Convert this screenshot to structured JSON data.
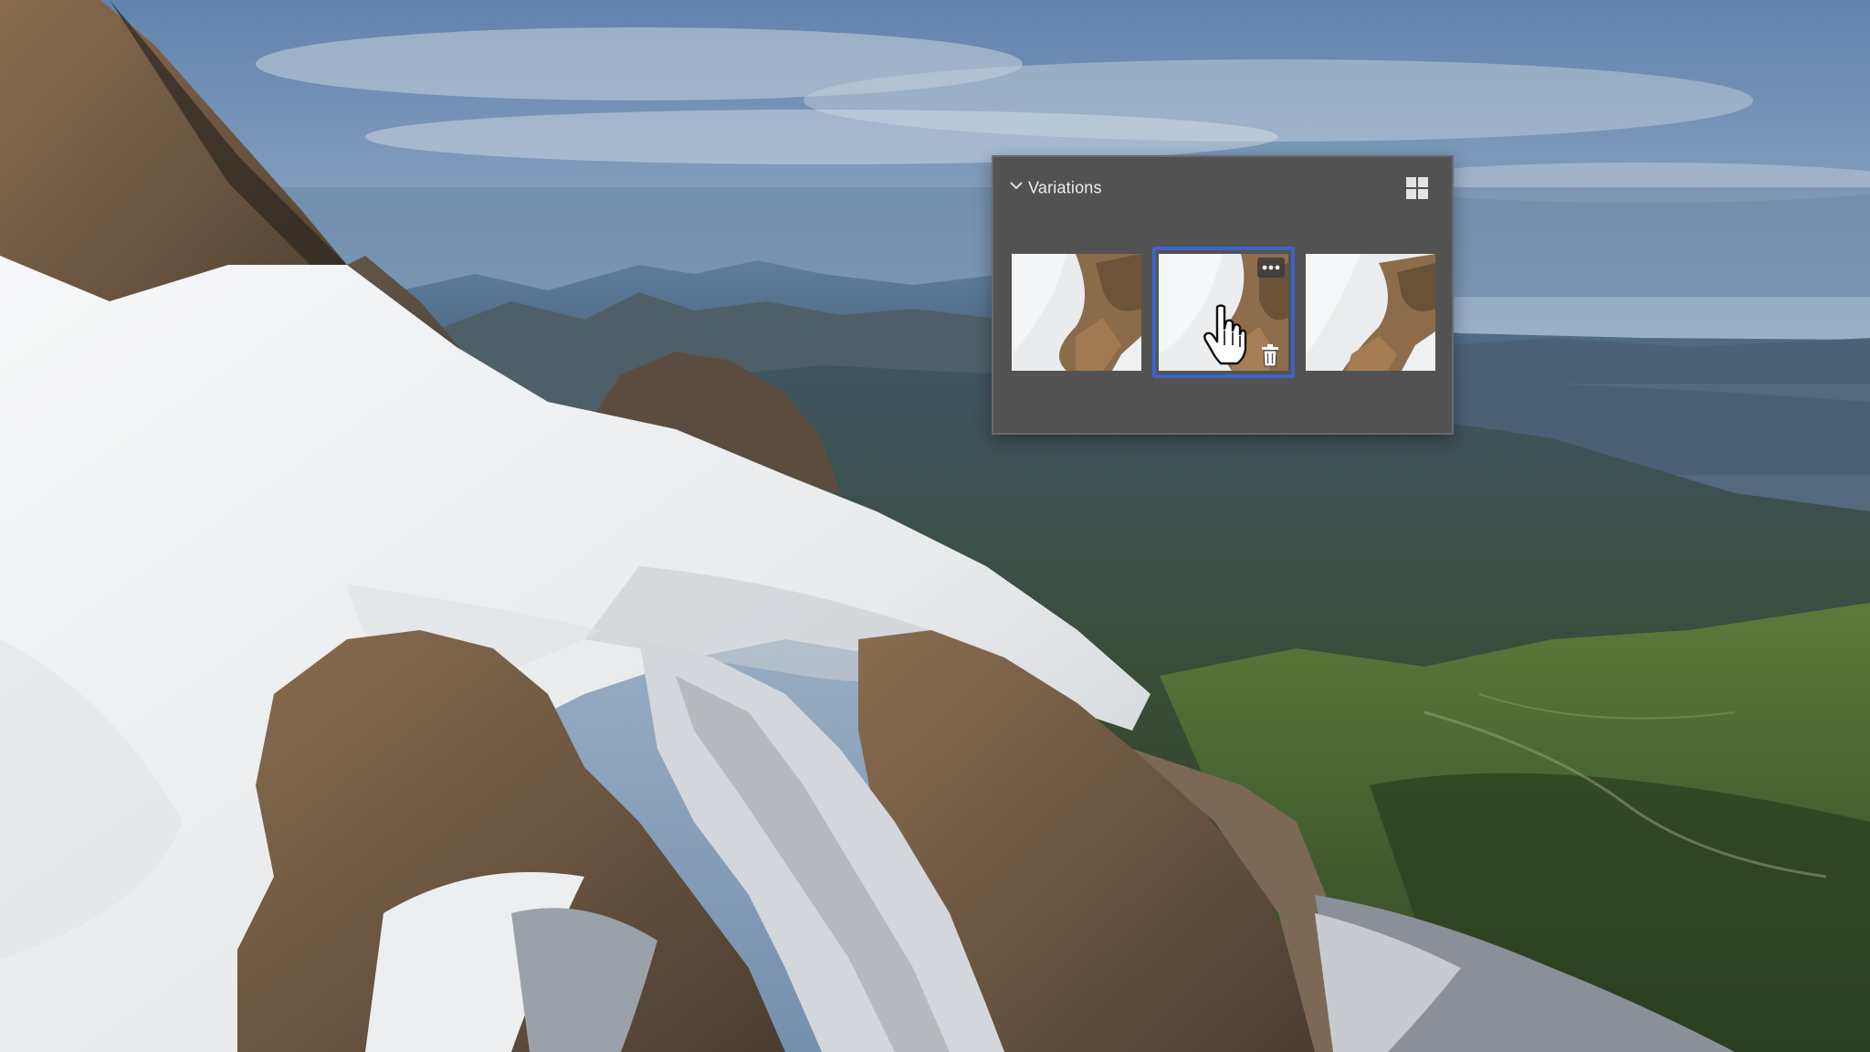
{
  "panel": {
    "title": "Variations",
    "expanded": true,
    "view_icon": "grid-view-icon",
    "selected_index": 1,
    "variations": [
      {
        "id": "variation-1"
      },
      {
        "id": "variation-2",
        "actions": [
          "more-icon",
          "trash-icon"
        ]
      },
      {
        "id": "variation-3"
      }
    ]
  },
  "colors": {
    "panel_bg": "#525252",
    "selection": "#3c63c9",
    "title_text": "#ededed"
  }
}
